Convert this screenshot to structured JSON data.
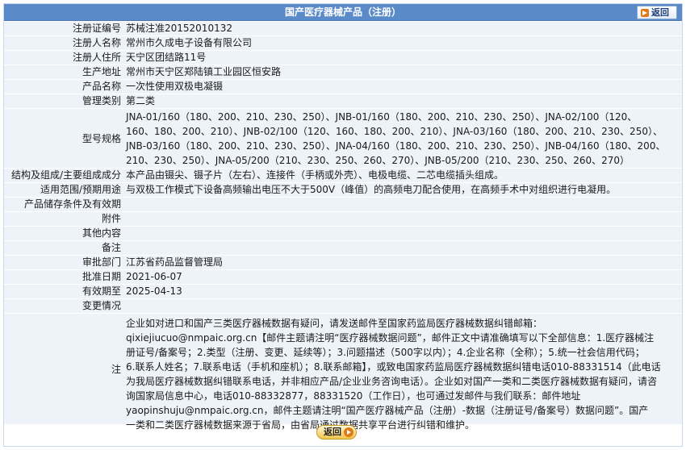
{
  "header": {
    "title": "国产医疗器械产品（注册）",
    "back_label": "返回"
  },
  "fields": {
    "reg_no": {
      "label": "注册证编号",
      "value": "苏械注准20152010132"
    },
    "registrant": {
      "label": "注册人名称",
      "value": "常州市久成电子设备有限公司"
    },
    "registrant_addr": {
      "label": "注册人住所",
      "value": "天宁区团结路11号"
    },
    "production_addr": {
      "label": "生产地址",
      "value": "常州市天宁区郑陆镇工业园区恒安路"
    },
    "product_name": {
      "label": "产品名称",
      "value": "一次性使用双极电凝镊"
    },
    "mgmt_class": {
      "label": "管理类别",
      "value": "第二类"
    },
    "models": {
      "label": "型号规格",
      "lines": [
        "JNA-01/160（180、200、210、230、250）、JNB-01/160（180、200、210、230、250）、JNA-02/100（120、",
        "160、180、200、210）、JNB-02/100（120、160、180、200、210）、JNA-03/160（180、200、210、230、250）、",
        "JNB-03/160（180、200、210、230、250）、JNA-04/160（180、200、210、230、250）、JNB-04/160（180、200、",
        "210、230、250）、JNA-05/200（210、230、250、260、270）、JNB-05/200（210、230、250、260、270）"
      ]
    },
    "structure": {
      "label": "结构及组成/主要组成成分",
      "value": "本产品由镊尖、镊子片（左右）、连接件（手柄或外壳）、电极电缆、二芯电缆插头组成。"
    },
    "scope": {
      "label": "适用范围/预期用途",
      "value": "与双极工作模式下设备高频输出电压不大于500V（峰值）的高频电刀配合使用，在高频手术中对组织进行电凝用。"
    },
    "storage": {
      "label": "产品储存条件及有效期",
      "value": ""
    },
    "attachments": {
      "label": "附件",
      "value": ""
    },
    "other": {
      "label": "其他内容",
      "value": ""
    },
    "remarks": {
      "label": "备注",
      "value": ""
    },
    "approver": {
      "label": "审批部门",
      "value": "江苏省药品监督管理局"
    },
    "approve_date": {
      "label": "批准日期",
      "value": "2021-06-07"
    },
    "valid_until": {
      "label": "有效期至",
      "value": "2025-04-13"
    },
    "changes": {
      "label": "变更情况",
      "value": ""
    },
    "note": {
      "label": "注",
      "lines": [
        "企业如对进口和国产三类医疗器械数据有疑问，请发送邮件至国家药监局医疗器械数据纠错邮箱：",
        "qixiejiucuo@nmpaic.org.cn【邮件主题请注明“医疗器械数据问题”，邮件正文中请准确填写以下全部信息：1.医疗器械注",
        "册证号/备案号；2.类型（注册、变更、延续等）；3.问题描述（500字以内）；4.企业名称（全称）；5.统一社会信用代码；",
        "6.联系人姓名；7.联系电话（手机和座机）；8.联系邮箱】，或致电国家药监局医疗器械数据纠错电话010-88331514（此电话",
        "为我局医疗器械数据纠错联系电话，并非相应产品/企业业务咨询电话）。企业如对国产一类和二类医疗器械数据有疑问，请咨",
        "询国家局信息中心，电话010-88332877，88331520（工作日），也可通过发邮件与我们联系：邮件地址",
        "yaopinshuju@nmpaic.org.cn，邮件主题请注明“国产医疗器械产品（注册）-数据（注册证号/备案号）数据问题”。国产",
        "一类和二类医疗器械数据来源于省局，由省局通过数据共享平台进行纠错和维护。"
      ]
    }
  },
  "footer": {
    "back_label": "返回"
  },
  "colors": {
    "header_bg": "#5b8ac8",
    "row_bg": "#eef3f9",
    "accent": "#e07a16"
  }
}
